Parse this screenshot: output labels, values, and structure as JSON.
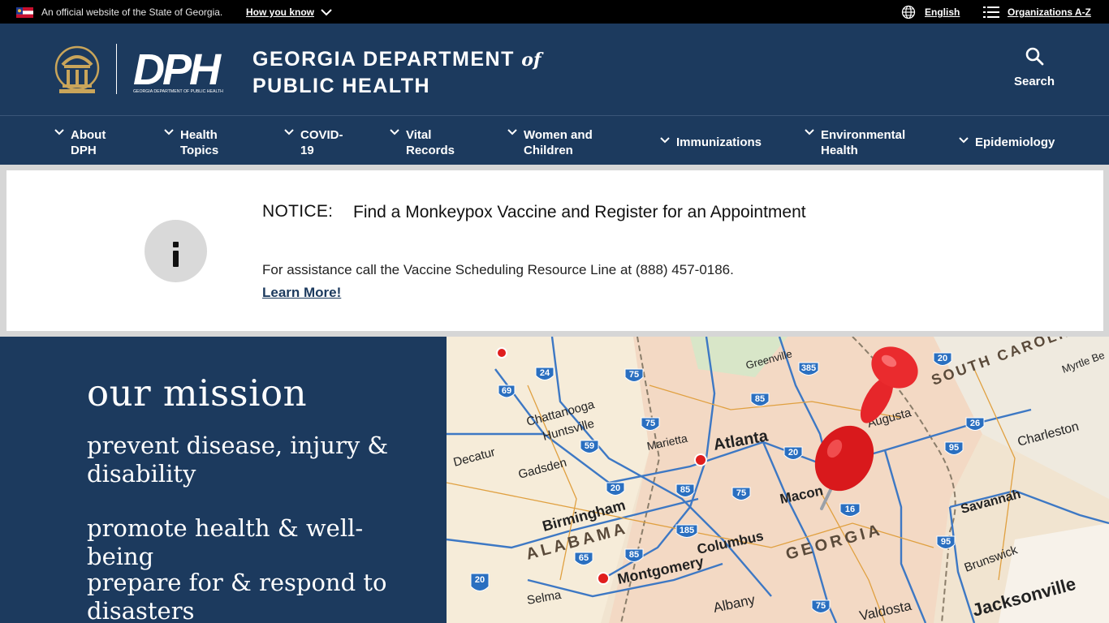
{
  "topbar": {
    "official_text": "An official website of the State of Georgia.",
    "how_link": "How you know",
    "language": "English",
    "orgs_link": "Organizations A-Z"
  },
  "header": {
    "logo_text": "DPH",
    "logo_sub": "GEORGIA DEPARTMENT OF PUBLIC HEALTH",
    "title_line1": "GEORGIA DEPARTMENT",
    "title_of": "of",
    "title_line2": "PUBLIC HEALTH",
    "search_label": "Search"
  },
  "nav": {
    "items": [
      {
        "line1": "About",
        "line2": "DPH"
      },
      {
        "line1": "Health",
        "line2": "Topics"
      },
      {
        "line1": "COVID-",
        "line2": "19"
      },
      {
        "line1": "Vital",
        "line2": "Records"
      },
      {
        "line1": "Women and",
        "line2": "Children"
      },
      {
        "line1": "Immunizations",
        "line2": ""
      },
      {
        "line1": "Environmental",
        "line2": "Health"
      },
      {
        "line1": "Epidemiology",
        "line2": ""
      }
    ]
  },
  "notice": {
    "label": "NOTICE:",
    "title": "Find a Monkeypox Vaccine and Register for an Appointment",
    "text": "For assistance call the Vaccine Scheduling Resource Line at (888) 457-0186.",
    "link": "Learn More!"
  },
  "mission": {
    "heading": "our mission",
    "goals": [
      "prevent disease, injury & disability",
      "promote health & well-being",
      "prepare for & respond to disasters"
    ]
  },
  "map": {
    "labels": {
      "atlanta": "Atlanta",
      "georgia": "GEORGIA",
      "alabama": "ALABAMA",
      "south_carolina": "SOUTH CAROLINA",
      "savannah": "Savannah",
      "jacksonville": "Jacksonville",
      "charleston": "Charleston",
      "birmingham": "Birmingham",
      "montgomery": "Montgomery",
      "columbus": "Columbus",
      "macon": "Macon",
      "chattanooga": "Chattanooga",
      "huntsville": "Huntsville",
      "decatur": "Decatur",
      "gadsden": "Gadsden",
      "marietta": "Marietta",
      "augusta": "Augusta",
      "brunswick": "Brunswick",
      "selma": "Selma",
      "albany": "Albany",
      "valdosta": "Valdosta",
      "greenville": "Greenville",
      "myrtle_beach": "Myrtle Be"
    }
  },
  "colors": {
    "navy": "#1c3a5e",
    "black_bar": "#000000",
    "notice_gray": "#d6d6d6",
    "pin_red": "#e01e1e"
  }
}
